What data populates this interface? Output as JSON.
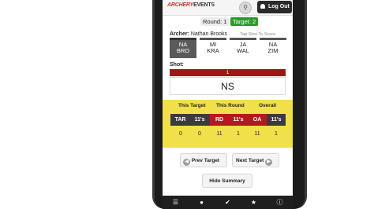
{
  "app": {
    "logo_prefix": "ARCHERY",
    "logo_suffix": "EVENTS"
  },
  "header": {
    "search_icon": "search-icon",
    "logout_label": "Log Out"
  },
  "status": {
    "round": "Round: 1",
    "target": "Target: 2"
  },
  "archer": {
    "label": "Archer:",
    "name": "Nathan Brooks",
    "hint": "- Tap Shot To Score"
  },
  "archers": [
    {
      "line1": "NA",
      "line2": "BRO"
    },
    {
      "line1": "MI",
      "line2": "KRA"
    },
    {
      "line1": "JA",
      "line2": "WAL"
    },
    {
      "line1": "NA",
      "line2": "ZIM"
    }
  ],
  "shot": {
    "label": "Shot:",
    "number": "1",
    "score": "NS"
  },
  "summary": {
    "headers": {
      "this_target": "This Target",
      "this_round": "This Round",
      "overall": "Overall"
    },
    "cells": [
      "TAR",
      "11's",
      "RD",
      "11's",
      "OA",
      "11's"
    ],
    "values": [
      "0",
      "0",
      "11",
      "1",
      "11",
      "1"
    ]
  },
  "buttons": {
    "prev": "Prev Target",
    "next": "Next Target",
    "hide": "Hide Summary"
  },
  "colors": {
    "accent_red": "#a31515",
    "target_green": "#2b9a2b",
    "summary_yellow": "#f1e04a"
  }
}
